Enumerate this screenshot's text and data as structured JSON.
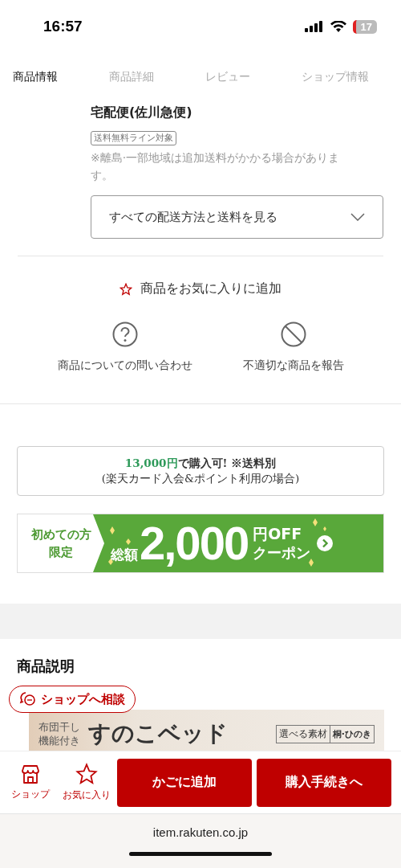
{
  "status_bar": {
    "time": "16:57",
    "battery": "17"
  },
  "tabs": [
    {
      "label": "商品情報",
      "selected": true
    },
    {
      "label": "商品詳細",
      "selected": false
    },
    {
      "label": "レビュー",
      "selected": false
    },
    {
      "label": "ショップ情報",
      "selected": false
    }
  ],
  "shipping": {
    "method": "宅配便(佐川急便)",
    "tag": "送料無料ライン対象",
    "note": "※離島·一部地域は追加送料がかかる場合があります。",
    "dropdown": "すべての配送方法と送料を見る"
  },
  "favorite": {
    "label": "商品をお気に入りに追加"
  },
  "actions": [
    {
      "kind": "question",
      "label": "商品についての問い合わせ"
    },
    {
      "kind": "report",
      "label": "不適切な商品を報告"
    }
  ],
  "promo": {
    "price": "13,000円",
    "line1": "で購入可! ※送料別",
    "line2": "(楽天カード入会&ポイント利用の場合)"
  },
  "coupon_banner": {
    "target": [
      "初めての方",
      "限定"
    ],
    "prefix": "総額",
    "amount": "2,000",
    "unit": "円OFF",
    "label": "クーポン"
  },
  "description": {
    "title": "商品説明",
    "consult_button": "ショップへ相談",
    "banner": {
      "feature": [
        "布団干し",
        "機能付き"
      ],
      "product": "すのこベッド",
      "material_label": "選べる素材",
      "material": "桐·ひのき"
    }
  },
  "bottom_bar": {
    "icons": [
      {
        "kind": "shop",
        "label": "ショップ"
      },
      {
        "kind": "star",
        "label": "お気に入り"
      }
    ],
    "buttons": [
      "かごに追加",
      "購入手続きへ"
    ]
  },
  "browser": {
    "url": "item.rakuten.co.jp"
  }
}
